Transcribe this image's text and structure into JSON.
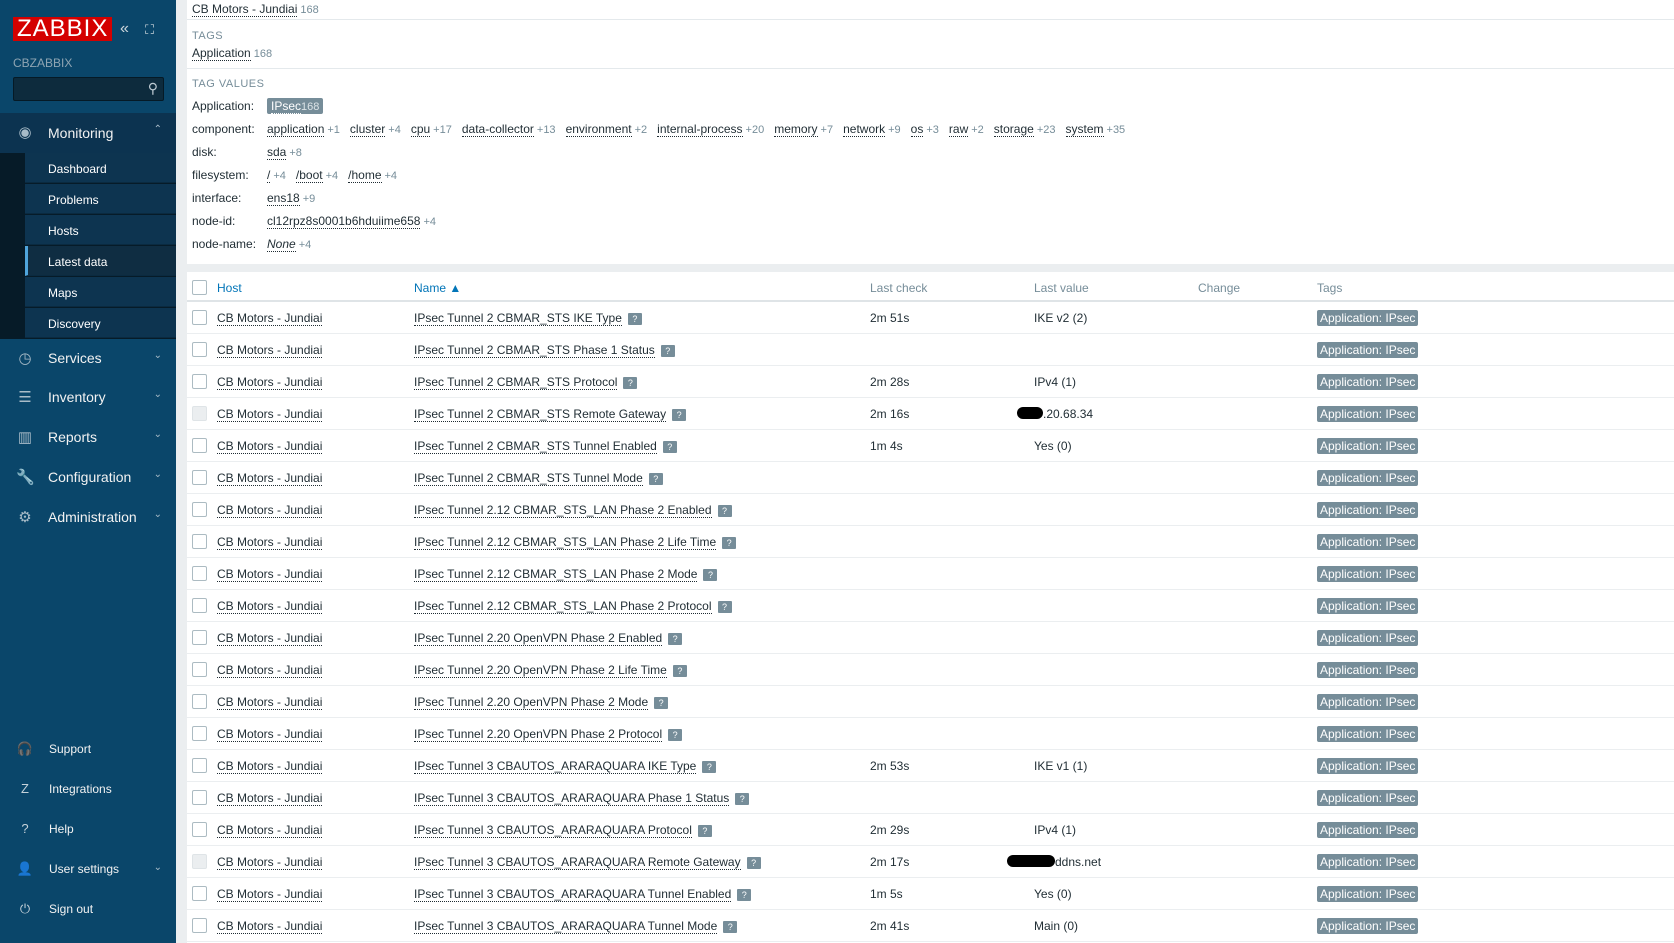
{
  "sidebar": {
    "logo": "ZABBIX",
    "server": "CBZABBIX",
    "search_placeholder": "",
    "monitoring": "Monitoring",
    "sub": [
      "Dashboard",
      "Problems",
      "Hosts",
      "Latest data",
      "Maps",
      "Discovery"
    ],
    "menu": [
      "Services",
      "Inventory",
      "Reports",
      "Configuration",
      "Administration"
    ],
    "footer": [
      "Support",
      "Integrations",
      "Help",
      "User settings",
      "Sign out"
    ]
  },
  "filter": {
    "partial_host": "CB Motors - Jundiai",
    "partial_count": "168",
    "tags_caption": "TAGS",
    "tag_name": "Application",
    "tag_count": "168",
    "tag_values_caption": "TAG VALUES",
    "rows": [
      {
        "key": "Application:",
        "vals": [
          {
            "v": "IPsec",
            "c": "168"
          }
        ]
      },
      {
        "key": "component:",
        "vals": [
          {
            "v": "application",
            "c": "+1"
          },
          {
            "v": "cluster",
            "c": "+4"
          },
          {
            "v": "cpu",
            "c": "+17"
          },
          {
            "v": "data-collector",
            "c": "+13"
          },
          {
            "v": "environment",
            "c": "+2"
          },
          {
            "v": "internal-process",
            "c": "+20"
          },
          {
            "v": "memory",
            "c": "+7"
          },
          {
            "v": "network",
            "c": "+9"
          },
          {
            "v": "os",
            "c": "+3"
          },
          {
            "v": "raw",
            "c": "+2"
          },
          {
            "v": "storage",
            "c": "+23"
          },
          {
            "v": "system",
            "c": "+35"
          }
        ]
      },
      {
        "key": "disk:",
        "vals": [
          {
            "v": "sda",
            "c": "+8"
          }
        ]
      },
      {
        "key": "filesystem:",
        "vals": [
          {
            "v": "/",
            "c": "+4"
          },
          {
            "v": "/boot",
            "c": "+4"
          },
          {
            "v": "/home",
            "c": "+4"
          }
        ]
      },
      {
        "key": "interface:",
        "vals": [
          {
            "v": "ens18",
            "c": "+9"
          }
        ]
      },
      {
        "key": "node-id:",
        "vals": [
          {
            "v": "cl12rpz8s0001b6hduiime658",
            "c": "+4"
          }
        ]
      },
      {
        "key": "node-name:",
        "vals": [
          {
            "v": "None",
            "c": "+4"
          }
        ]
      }
    ]
  },
  "table": {
    "headers": {
      "host": "Host",
      "name": "Name ▲",
      "last_check": "Last check",
      "last_value": "Last value",
      "change": "Change",
      "tags": "Tags"
    },
    "help_icon": "?",
    "rows": [
      {
        "host": "CB Motors - Jundiai",
        "name": "IPsec Tunnel 2 CBMAR_STS IKE Type",
        "check": "2m 51s",
        "value": "IKE v2 (2)",
        "tag": "Application: IPsec"
      },
      {
        "host": "CB Motors - Jundiai",
        "name": "IPsec Tunnel 2 CBMAR_STS Phase 1 Status",
        "check": "",
        "value": "",
        "tag": "Application: IPsec"
      },
      {
        "host": "CB Motors - Jundiai",
        "name": "IPsec Tunnel 2 CBMAR_STS Protocol",
        "check": "2m 28s",
        "value": "IPv4 (1)",
        "tag": "Application: IPsec"
      },
      {
        "host": "CB Motors - Jundiai",
        "name": "IPsec Tunnel 2 CBMAR_STS Remote Gateway",
        "check": "2m 16s",
        "value": ".20.68.34",
        "redacted": true,
        "disabled": true,
        "tag": "Application: IPsec"
      },
      {
        "host": "CB Motors - Jundiai",
        "name": "IPsec Tunnel 2 CBMAR_STS Tunnel Enabled",
        "check": "1m 4s",
        "value": "Yes (0)",
        "tag": "Application: IPsec"
      },
      {
        "host": "CB Motors - Jundiai",
        "name": "IPsec Tunnel 2 CBMAR_STS Tunnel Mode",
        "check": "",
        "value": "",
        "tag": "Application: IPsec"
      },
      {
        "host": "CB Motors - Jundiai",
        "name": "IPsec Tunnel 2.12 CBMAR_STS_LAN Phase 2 Enabled",
        "check": "",
        "value": "",
        "tag": "Application: IPsec"
      },
      {
        "host": "CB Motors - Jundiai",
        "name": "IPsec Tunnel 2.12 CBMAR_STS_LAN Phase 2 Life Time",
        "check": "",
        "value": "",
        "tag": "Application: IPsec"
      },
      {
        "host": "CB Motors - Jundiai",
        "name": "IPsec Tunnel 2.12 CBMAR_STS_LAN Phase 2 Mode",
        "check": "",
        "value": "",
        "tag": "Application: IPsec"
      },
      {
        "host": "CB Motors - Jundiai",
        "name": "IPsec Tunnel 2.12 CBMAR_STS_LAN Phase 2 Protocol",
        "check": "",
        "value": "",
        "tag": "Application: IPsec"
      },
      {
        "host": "CB Motors - Jundiai",
        "name": "IPsec Tunnel 2.20 OpenVPN Phase 2 Enabled",
        "check": "",
        "value": "",
        "tag": "Application: IPsec"
      },
      {
        "host": "CB Motors - Jundiai",
        "name": "IPsec Tunnel 2.20 OpenVPN Phase 2 Life Time",
        "check": "",
        "value": "",
        "tag": "Application: IPsec"
      },
      {
        "host": "CB Motors - Jundiai",
        "name": "IPsec Tunnel 2.20 OpenVPN Phase 2 Mode",
        "check": "",
        "value": "",
        "tag": "Application: IPsec"
      },
      {
        "host": "CB Motors - Jundiai",
        "name": "IPsec Tunnel 2.20 OpenVPN Phase 2 Protocol",
        "check": "",
        "value": "",
        "tag": "Application: IPsec"
      },
      {
        "host": "CB Motors - Jundiai",
        "name": "IPsec Tunnel 3 CBAUTOS_ARARAQUARA IKE Type",
        "check": "2m 53s",
        "value": "IKE v1 (1)",
        "tag": "Application: IPsec"
      },
      {
        "host": "CB Motors - Jundiai",
        "name": "IPsec Tunnel 3 CBAUTOS_ARARAQUARA Phase 1 Status",
        "check": "",
        "value": "",
        "tag": "Application: IPsec"
      },
      {
        "host": "CB Motors - Jundiai",
        "name": "IPsec Tunnel 3 CBAUTOS_ARARAQUARA Protocol",
        "check": "2m 29s",
        "value": "IPv4 (1)",
        "tag": "Application: IPsec"
      },
      {
        "host": "CB Motors - Jundiai",
        "name": "IPsec Tunnel 3 CBAUTOS_ARARAQUARA Remote Gateway",
        "check": "2m 17s",
        "value": "ddns.net",
        "redacted": true,
        "disabled": true,
        "tag": "Application: IPsec"
      },
      {
        "host": "CB Motors - Jundiai",
        "name": "IPsec Tunnel 3 CBAUTOS_ARARAQUARA Tunnel Enabled",
        "check": "1m 5s",
        "value": "Yes (0)",
        "tag": "Application: IPsec"
      },
      {
        "host": "CB Motors - Jundiai",
        "name": "IPsec Tunnel 3 CBAUTOS_ARARAQUARA Tunnel Mode",
        "check": "2m 41s",
        "value": "Main (0)",
        "tag": "Application: IPsec"
      }
    ]
  }
}
